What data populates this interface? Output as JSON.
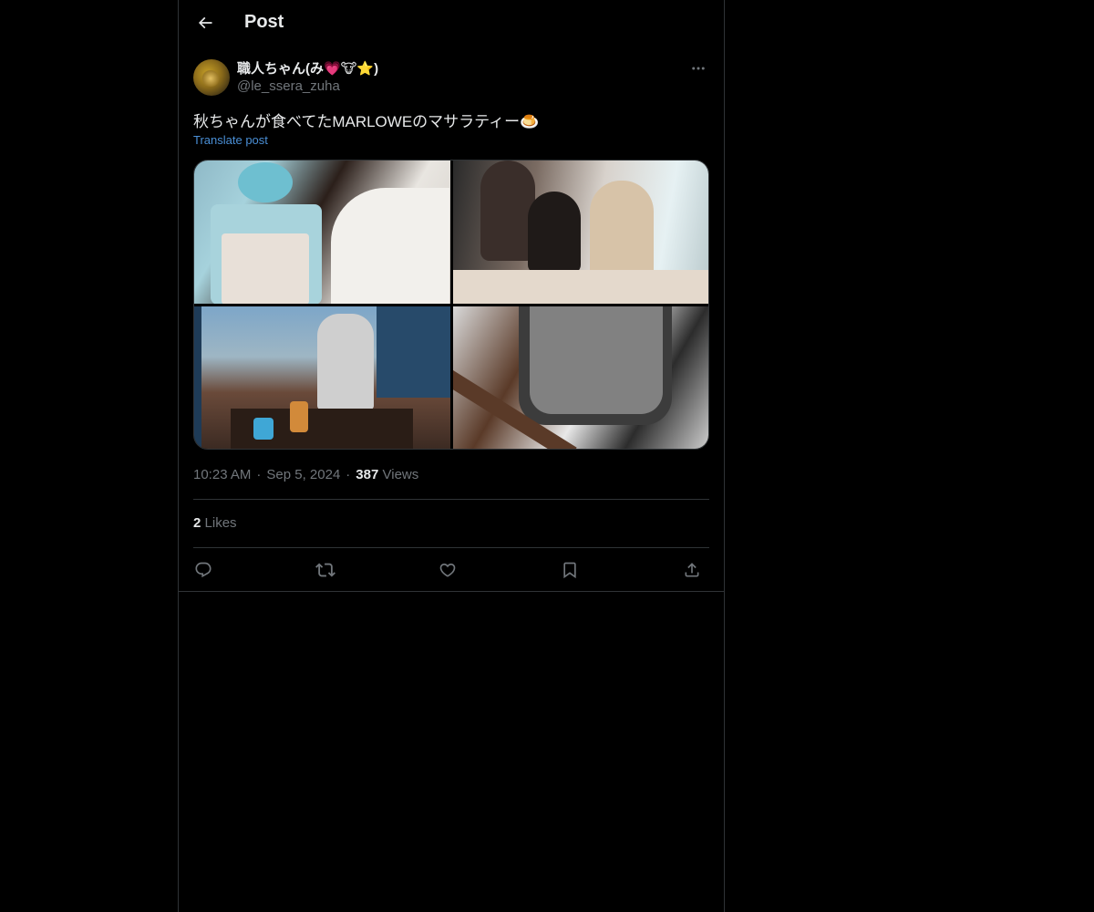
{
  "header": {
    "title": "Post",
    "back_icon": "arrow-left-icon"
  },
  "author": {
    "display_name": "職人ちゃん(み💗🐮⭐)",
    "handle": "@le_ssera_zuha",
    "more_icon": "more-horizontal-icon"
  },
  "post": {
    "text": "秋ちゃんが食べてたMARLOWEのマサラティー🍮",
    "translate_label": "Translate post",
    "media": [
      {
        "name": "photo-hangyodon-card"
      },
      {
        "name": "photo-three-women"
      },
      {
        "name": "photo-cafe-window"
      },
      {
        "name": "photo-marlowe-cup"
      }
    ]
  },
  "meta": {
    "time": "10:23 AM",
    "separator": "·",
    "date": "Sep 5, 2024",
    "views_count": "387",
    "views_label": "Views"
  },
  "likes": {
    "count": "2",
    "label": "Likes"
  },
  "actions": [
    {
      "name": "reply-button",
      "icon": "reply-icon"
    },
    {
      "name": "repost-button",
      "icon": "repost-icon"
    },
    {
      "name": "like-button",
      "icon": "heart-icon"
    },
    {
      "name": "bookmark-button",
      "icon": "bookmark-icon"
    },
    {
      "name": "share-button",
      "icon": "share-icon"
    }
  ],
  "colors": {
    "background": "#000000",
    "text": "#e7e9ea",
    "secondary_text": "#71767b",
    "link": "#4a8fd6",
    "border": "#2f3336"
  }
}
